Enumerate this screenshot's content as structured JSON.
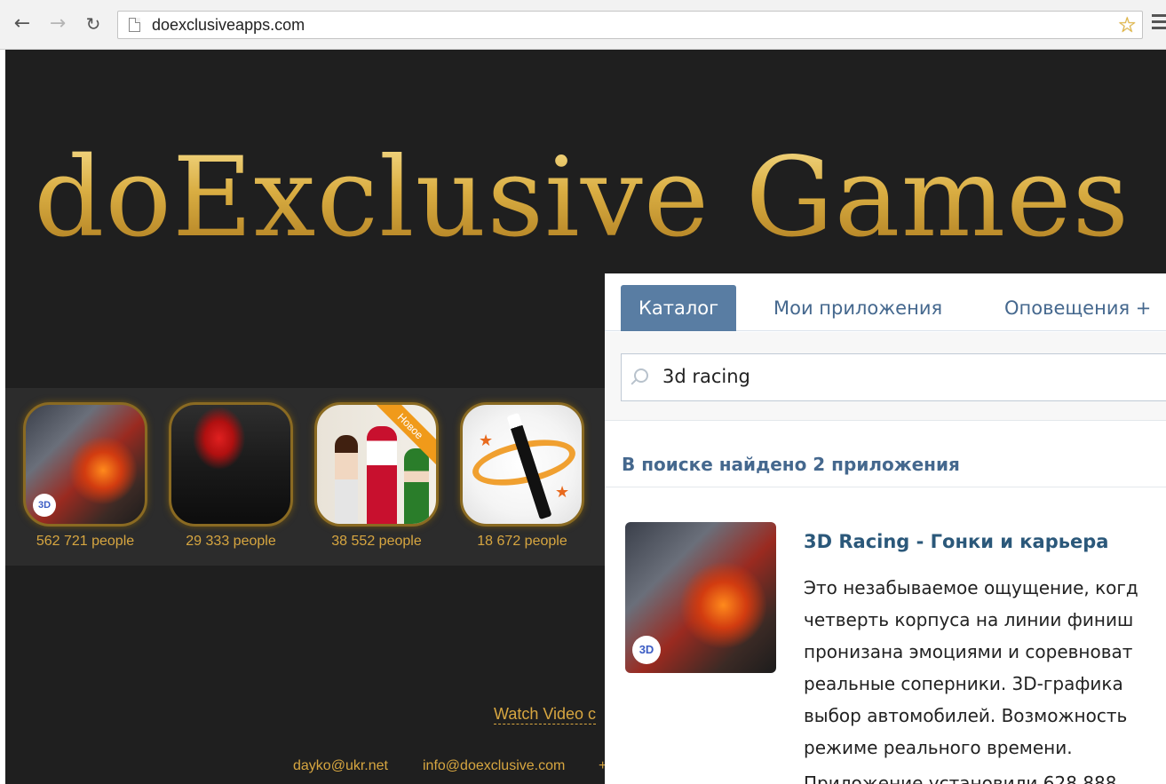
{
  "browser": {
    "url": "doexclusiveapps.com",
    "icons": {
      "back": "arrow-left-icon",
      "forward": "arrow-right-icon",
      "reload": "reload-icon",
      "page": "page-icon",
      "bookmark": "star-icon",
      "menu": "menu-icon"
    }
  },
  "site": {
    "logo": "doExclusive Games",
    "apps": [
      {
        "count": "562 721 people",
        "badge": "3D"
      },
      {
        "count": "29 333 people"
      },
      {
        "count": "38 552 people",
        "ribbon": "Новое"
      },
      {
        "count": "18 672 people"
      }
    ],
    "watch_video": "Watch Video c",
    "footer": {
      "email1": "dayko@ukr.net",
      "email2": "info@doexclusive.com",
      "extra": "+"
    },
    "colors": {
      "background": "#1f1f1f",
      "strip": "#2c2c2c",
      "gold": "#d7a640"
    }
  },
  "vk": {
    "tabs": [
      {
        "label": "Каталог",
        "active": true
      },
      {
        "label": "Мои приложения",
        "active": false
      },
      {
        "label": "Оповещения +",
        "active": false
      }
    ],
    "search": {
      "value": "3d racing"
    },
    "found_text": "В поиске найдено 2 приложения",
    "result": {
      "badge": "3D",
      "title": "3D Racing - Гонки и карьера",
      "description_lines": [
        "Это незабываемое ощущение, когд",
        "четверть корпуса на линии финиш",
        "пронизана эмоциями и соревноват",
        "реальные соперники. 3D-графика",
        "выбор автомобилей. Возможность",
        "режиме реального времени."
      ],
      "users_line": "Приложение установили 628 888"
    },
    "colors": {
      "tab_active": "#597da3",
      "link": "#45688e"
    }
  }
}
